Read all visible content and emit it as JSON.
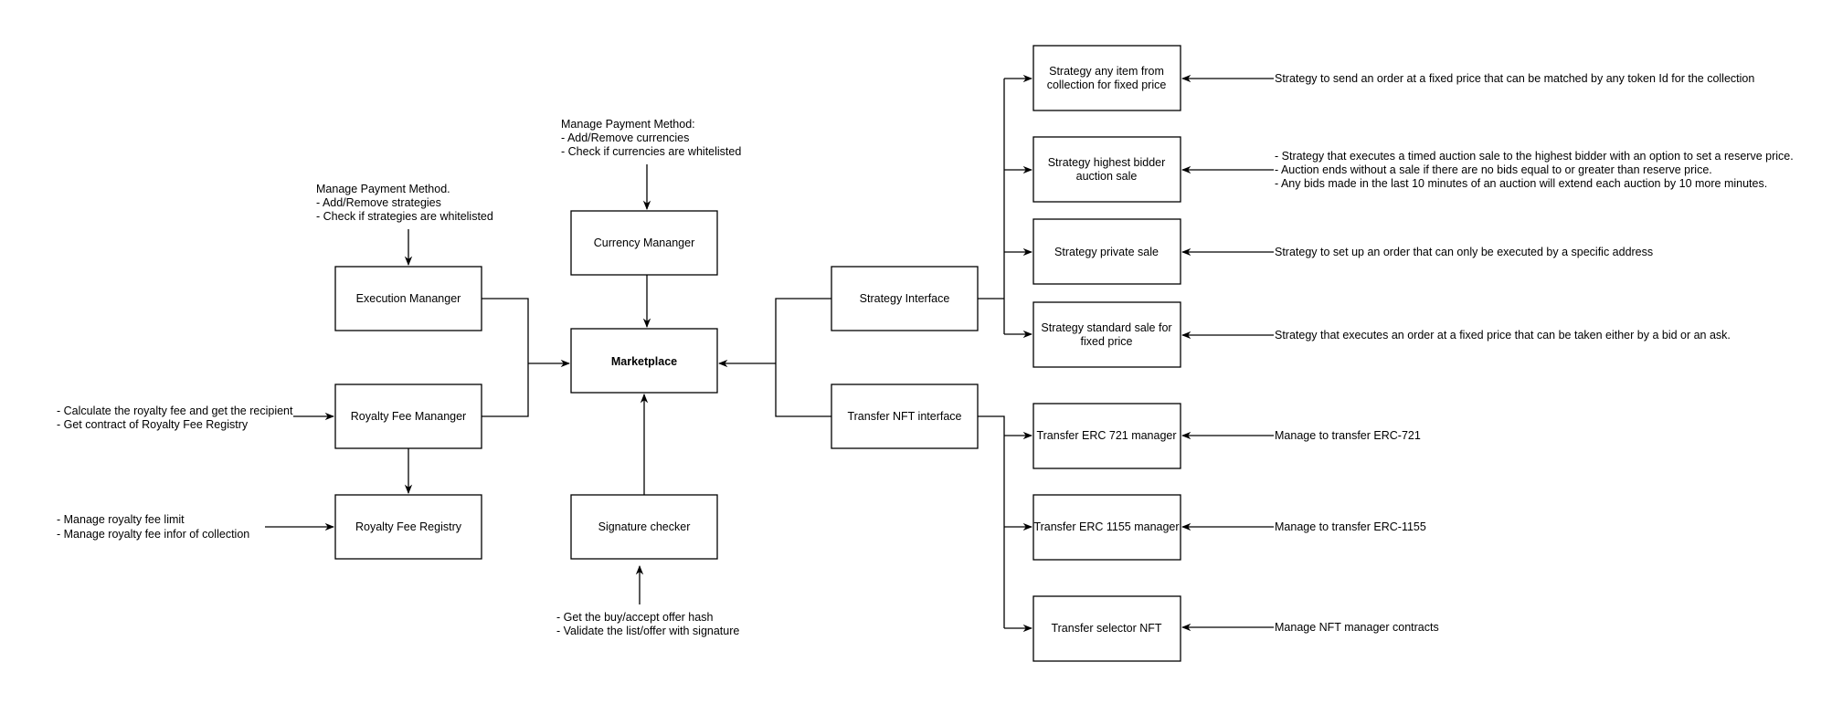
{
  "nodes": {
    "execution": "Execution Mananger",
    "royalty_manager": "Royalty Fee Mananger",
    "royalty_registry": "Royalty Fee Registry",
    "currency": "Currency Mananger",
    "marketplace": "Marketplace",
    "signature": "Signature checker",
    "strategy_interface": "Strategy Interface",
    "transfer_interface": "Transfer NFT interface",
    "strategy_any_item": [
      "Strategy any item from",
      "collection for fixed price"
    ],
    "strategy_highest_bidder": [
      "Strategy highest bidder",
      "auction sale"
    ],
    "strategy_private": "Strategy private sale",
    "strategy_standard": [
      "Strategy standard sale for",
      "fixed price"
    ],
    "transfer_721": "Transfer ERC 721 manager",
    "transfer_1155": "Transfer ERC 1155 manager",
    "transfer_selector": "Transfer selector NFT"
  },
  "notes": {
    "currency": [
      "Manage Payment Method:",
      "- Add/Remove currencies",
      "- Check if currencies are whitelisted"
    ],
    "execution": [
      "Manage Payment Method.",
      "- Add/Remove strategies",
      "- Check if strategies are whitelisted"
    ],
    "royalty_manager": [
      "- Calculate the royalty fee and get the recipient",
      "- Get contract of Royalty Fee Registry"
    ],
    "royalty_registry": [
      "- Manage royalty fee limit",
      "- Manage royalty fee infor of collection"
    ],
    "signature": [
      "- Get the buy/accept offer hash",
      "- Validate the list/offer with signature"
    ],
    "strategy_any_item": "Strategy to send an order at a fixed price that can be matched by any token Id for the collection",
    "strategy_highest_bidder": [
      "- Strategy that executes a timed auction sale to the highest bidder with an option to set a reserve price.",
      "- Auction ends without a sale if there are no bids equal to or greater than reserve price.",
      "- Any bids made in the last 10 minutes of an auction will extend each auction by 10 more minutes."
    ],
    "strategy_private": "Strategy to set up an order that can only be executed by a specific address",
    "strategy_standard": "Strategy that executes an order at a fixed price that can be taken either by a bid or an ask.",
    "transfer_721": "Manage to transfer ERC-721",
    "transfer_1155": "Manage to transfer ERC-1155",
    "transfer_selector": "Manage NFT manager contracts"
  }
}
